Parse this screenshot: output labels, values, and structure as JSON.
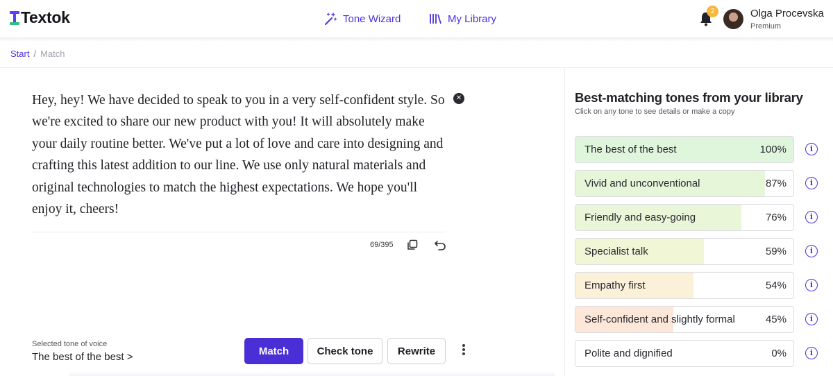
{
  "brand": {
    "name": "Textok",
    "accent": "#4b32d8",
    "logo_green": "#2fc07f"
  },
  "nav": {
    "wizard_label": "Tone Wizard",
    "library_label": "My Library"
  },
  "user": {
    "notifications": "2",
    "name": "Olga Procevska",
    "plan": "Premium"
  },
  "breadcrumb": {
    "start": "Start",
    "separator": "/",
    "current": "Match"
  },
  "editor": {
    "text": "Hey, hey! We have decided to speak to you in a very self-confident style. So we're excited to share our new product with you! It will absolutely make your daily routine better. We've put a lot of love and care into designing and crafting this latest addition to our line. We use only natural materials and original technologies to match the highest expectations. We hope you'll enjoy it, cheers!",
    "counter": "69/395"
  },
  "selected_tone": {
    "label": "Selected tone of voice",
    "value": "The best of the best >"
  },
  "actions": {
    "match": "Match",
    "check": "Check tone",
    "rewrite": "Rewrite"
  },
  "panel": {
    "title": "Best-matching tones from your library",
    "subtitle": "Click on any tone to see details or make a copy",
    "tones": [
      {
        "name": "The best of the best",
        "percent": "100%",
        "level": 1.0,
        "color": "#dff6dd"
      },
      {
        "name": "Vivid and unconventional",
        "percent": "87%",
        "level": 0.87,
        "color": "#e6f6d9"
      },
      {
        "name": "Friendly and easy-going",
        "percent": "76%",
        "level": 0.76,
        "color": "#eaf6d8"
      },
      {
        "name": "Specialist talk",
        "percent": "59%",
        "level": 0.59,
        "color": "#f1f6d6"
      },
      {
        "name": "Empathy first",
        "percent": "54%",
        "level": 0.54,
        "color": "#fbf0d8"
      },
      {
        "name": "Self-confident and slightly formal",
        "percent": "45%",
        "level": 0.45,
        "color": "#fde7d8"
      },
      {
        "name": "Polite and dignified",
        "percent": "0%",
        "level": 0.0,
        "color": "#ffffff"
      }
    ]
  }
}
